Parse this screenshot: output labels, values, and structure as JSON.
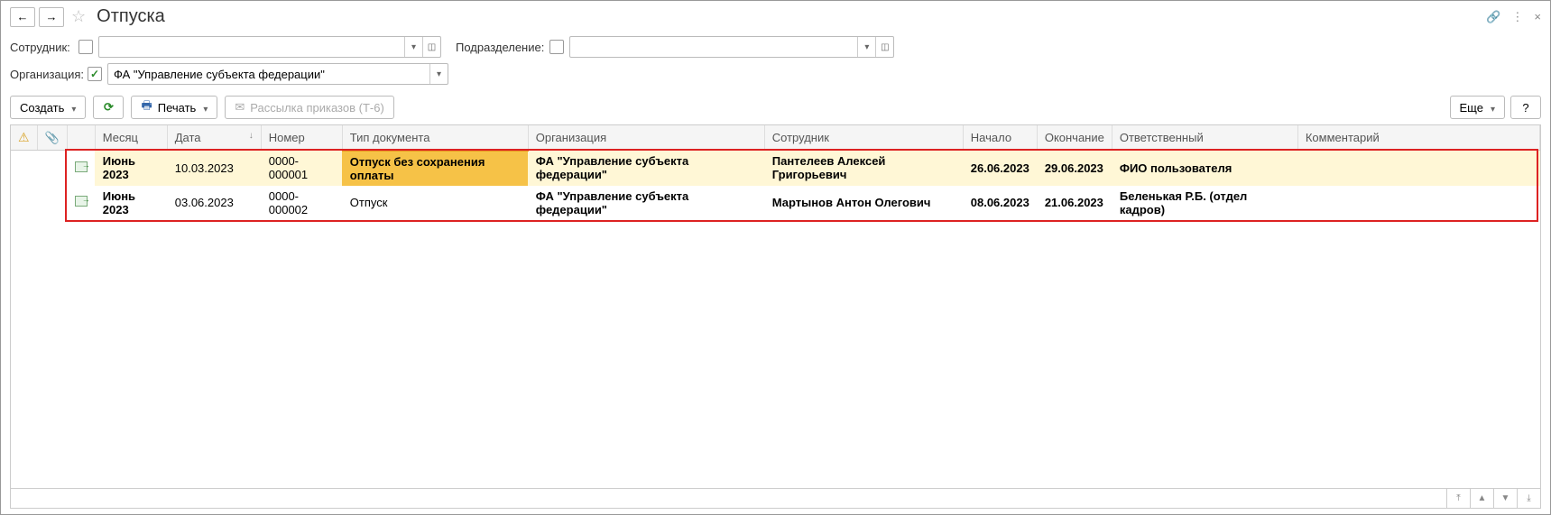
{
  "title": "Отпуска",
  "filters": {
    "employee_label": "Сотрудник:",
    "employee_checked": false,
    "employee_value": "",
    "department_label": "Подразделение:",
    "department_checked": false,
    "department_value": "",
    "organization_label": "Организация:",
    "organization_checked": true,
    "organization_value": "ФА \"Управление субъекта федерации\""
  },
  "toolbar": {
    "create_label": "Создать",
    "print_label": "Печать",
    "mailing_label": "Рассылка приказов (Т-6)",
    "more_label": "Еще",
    "help_label": "?"
  },
  "columns": {
    "warn": "",
    "attach": "",
    "icon": "",
    "month": "Месяц",
    "date": "Дата",
    "number": "Номер",
    "doc_type": "Тип документа",
    "organization": "Организация",
    "employee": "Сотрудник",
    "start": "Начало",
    "end": "Окончание",
    "responsible": "Ответственный",
    "comment": "Комментарий"
  },
  "rows": [
    {
      "month": "Июнь 2023",
      "date": "10.03.2023",
      "number": "0000-000001",
      "doc_type": "Отпуск без сохранения оплаты",
      "organization": "ФА \"Управление субъекта федерации\"",
      "employee": "Пантелеев Алексей Григорьевич",
      "start": "26.06.2023",
      "end": "29.06.2023",
      "responsible": "ФИО пользователя",
      "comment": "",
      "highlighted_type": true
    },
    {
      "month": "Июнь 2023",
      "date": "03.06.2023",
      "number": "0000-000002",
      "doc_type": "Отпуск",
      "organization": "ФА \"Управление субъекта федерации\"",
      "employee": "Мартынов Антон Олегович",
      "start": "08.06.2023",
      "end": "21.06.2023",
      "responsible": "Беленькая Р.Б. (отдел кадров)",
      "comment": "",
      "highlighted_type": false
    }
  ]
}
